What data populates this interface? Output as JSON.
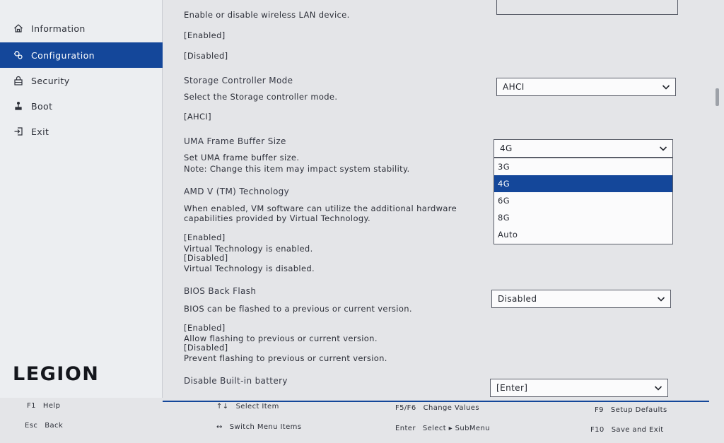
{
  "sidebar": {
    "items": [
      {
        "label": "Information",
        "icon": "home-icon",
        "active": false
      },
      {
        "label": "Configuration",
        "icon": "configuration-icon",
        "active": true
      },
      {
        "label": "Security",
        "icon": "lock-icon",
        "active": false
      },
      {
        "label": "Boot",
        "icon": "boot-icon",
        "active": false
      },
      {
        "label": "Exit",
        "icon": "exit-icon",
        "active": false
      }
    ],
    "logo": "LEGION"
  },
  "content": {
    "wlan": {
      "description": "Enable or disable wireless LAN device.",
      "option_enabled": "[Enabled]",
      "option_disabled": "[Disabled]"
    },
    "storage": {
      "title": "Storage Controller Mode",
      "description": "Select the Storage controller mode.",
      "option": "[AHCI]",
      "value": "AHCI"
    },
    "uma": {
      "title": "UMA Frame Buffer Size",
      "description": "Set UMA frame buffer size.",
      "note": "Note: Change this item may impact system stability.",
      "value": "4G",
      "options": [
        "3G",
        "4G",
        "6G",
        "8G",
        "Auto"
      ],
      "highlighted": "4G"
    },
    "amdv": {
      "title": "AMD V (TM) Technology",
      "description_1": "When enabled, VM software can utilize the additional hardware",
      "description_2": "capabilities provided by Virtual Technology.",
      "enabled_label": "[Enabled]",
      "enabled_text": "Virtual Technology is enabled.",
      "disabled_label": "[Disabled]",
      "disabled_text": "Virtual Technology is disabled."
    },
    "bios_back_flash": {
      "title": "BIOS Back Flash",
      "description": "BIOS can be flashed  to a previous or current version.",
      "enabled_label": "[Enabled]",
      "enabled_text": "Allow flashing to previous or current version.",
      "disabled_label": "[Disabled]",
      "disabled_text": "Prevent flashing to previous or current version.",
      "value": "Disabled"
    },
    "battery": {
      "title": "Disable Built-in battery",
      "value": "[Enter]"
    }
  },
  "footer": {
    "f1": {
      "key": "F1",
      "label": "Help"
    },
    "esc": {
      "key": "Esc",
      "label": "Back"
    },
    "updown": {
      "key": "↑↓",
      "label": "Select Item"
    },
    "leftright": {
      "key": "↔",
      "label": "Switch Menu Items"
    },
    "f5f6": {
      "key": "F5/F6",
      "label": "Change Values"
    },
    "enter": {
      "key": "Enter",
      "label": "Select ▸ SubMenu"
    },
    "f9": {
      "key": "F9",
      "label": "Setup Defaults"
    },
    "f10": {
      "key": "F10",
      "label": "Save and Exit"
    }
  },
  "colors": {
    "accent": "#14479a",
    "background": "#e4e5e8",
    "sidebar": "#eceef1"
  }
}
